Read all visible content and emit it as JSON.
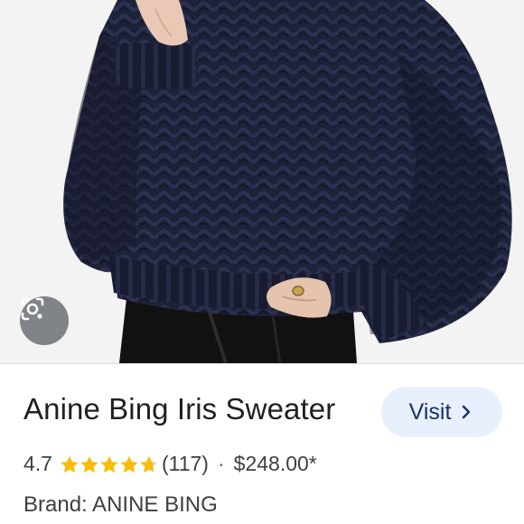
{
  "product": {
    "title": "Anine Bing Iris Sweater",
    "rating": "4.7",
    "rating_value": 4.7,
    "review_count": "(117)",
    "separator": "·",
    "price": "$248.00*",
    "brand": "Brand: ANINE BING"
  },
  "actions": {
    "visit_label": "Visit"
  },
  "colors": {
    "star": "#fbbc04",
    "visit_bg": "#e8f0fe",
    "visit_text": "#1a2f6b",
    "sweater": "#1b1f33"
  }
}
